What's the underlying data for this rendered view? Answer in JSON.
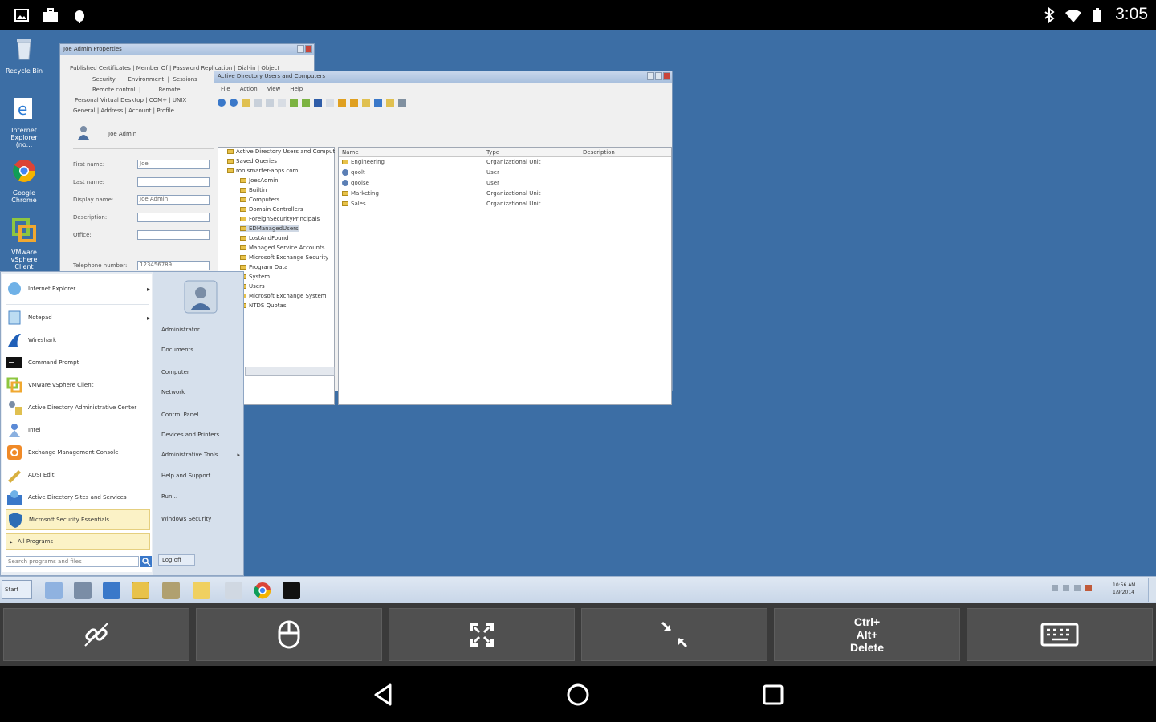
{
  "statusbar": {
    "time": "3:05",
    "left_icons": [
      "image-icon",
      "briefcase-icon",
      "debug-icon"
    ],
    "right_icons": [
      "bluetooth-icon",
      "wifi-icon",
      "battery-icon"
    ]
  },
  "desktop": {
    "background": "#3c6ea5",
    "icons": [
      {
        "label": "Recycle Bin",
        "icon": "recycle-bin-icon"
      },
      {
        "label": "Internet Explorer (no...",
        "icon": "internet-explorer-icon"
      },
      {
        "label": "Google Chrome",
        "icon": "chrome-icon"
      },
      {
        "label": "VMware vSphere Client",
        "icon": "vsphere-icon"
      }
    ]
  },
  "props_window": {
    "title": "Joe Admin Properties",
    "tabs_row1": [
      "Published Certificates",
      "Member Of",
      "Password Replication",
      "Dial-in",
      "Object"
    ],
    "tabs_row2": [
      "Security",
      "Environment",
      "Sessions"
    ],
    "tabs_row3": [
      "Remote control",
      "Remote"
    ],
    "tabs_row4": [
      "Personal Virtual Desktop",
      "COM+",
      "UNIX"
    ],
    "tabs_row5": [
      "General",
      "Address",
      "Account",
      "Profile"
    ],
    "user_display": "Joe Admin",
    "fields": [
      {
        "label": "First name:",
        "value": "Joe"
      },
      {
        "label": "Last name:",
        "value": ""
      },
      {
        "label": "Display name:",
        "value": "Joe Admin"
      },
      {
        "label": "Description:",
        "value": ""
      },
      {
        "label": "Office:",
        "value": ""
      },
      {
        "label": "Telephone number:",
        "value": "123456789"
      }
    ]
  },
  "aduc_window": {
    "title": "Active Directory Users and Computers",
    "menu": [
      "File",
      "Action",
      "View",
      "Help"
    ],
    "tree": [
      "Active Directory Users and Comput",
      "Saved Queries",
      "ron.smarter-apps.com",
      "JoesAdmin",
      "Builtin",
      "Computers",
      "Domain Controllers",
      "ForeignSecurityPrincipals",
      "EDManagedUsers",
      "LostAndFound",
      "Managed Service Accounts",
      "Microsoft Exchange Security",
      "Program Data",
      "System",
      "Users",
      "Microsoft Exchange System",
      "NTDS Quotas"
    ],
    "columns": [
      "Name",
      "Type",
      "Description"
    ],
    "rows": [
      {
        "name": "Engineering",
        "type": "Organizational Unit",
        "description": "",
        "icon": "ou-icon"
      },
      {
        "name": "qoolt",
        "type": "User",
        "description": "",
        "icon": "user-icon"
      },
      {
        "name": "qoolse",
        "type": "User",
        "description": "",
        "icon": "user-icon"
      },
      {
        "name": "Marketing",
        "type": "Organizational Unit",
        "description": "",
        "icon": "ou-icon"
      },
      {
        "name": "Sales",
        "type": "Organizational Unit",
        "description": "",
        "icon": "ou-icon"
      }
    ]
  },
  "start_menu": {
    "left_items": [
      {
        "label": "Internet Explorer",
        "icon": "ie-icon",
        "arrow": true
      },
      {
        "label": "Notepad",
        "icon": "notepad-icon",
        "arrow": true
      },
      {
        "label": "Wireshark",
        "icon": "wireshark-icon",
        "arrow": false
      },
      {
        "label": "Command Prompt",
        "icon": "cmd-icon",
        "arrow": false
      },
      {
        "label": "VMware vSphere Client",
        "icon": "vsphere-icon",
        "arrow": false
      },
      {
        "label": "Active Directory Administrative Center",
        "icon": "adac-icon",
        "arrow": false
      },
      {
        "label": "Intel",
        "icon": "intel-icon",
        "arrow": false
      },
      {
        "label": "Exchange Management Console",
        "icon": "exchange-icon",
        "arrow": false
      },
      {
        "label": "ADSI Edit",
        "icon": "adsi-icon",
        "arrow": false
      },
      {
        "label": "Active Directory Sites and Services",
        "icon": "adss-icon",
        "arrow": false
      },
      {
        "label": "Microsoft Security Essentials",
        "icon": "mse-icon",
        "arrow": false
      }
    ],
    "all_programs": "All Programs",
    "search_placeholder": "Search programs and files",
    "right_items": [
      "Administrator",
      "Documents",
      "Computer",
      "Network",
      "Control Panel",
      "Devices and Printers",
      "Administrative Tools",
      "Help and Support",
      "Run...",
      "Windows Security"
    ],
    "logoff": "Log off"
  },
  "taskbar": {
    "start_label": "Start",
    "tray_time": "10:56 AM",
    "tray_date": "1/9/2014"
  },
  "remote_toolbar": {
    "buttons": [
      {
        "name": "disconnect-button",
        "icon": "unlink-icon"
      },
      {
        "name": "mouse-button",
        "icon": "mouse-icon"
      },
      {
        "name": "fullscreen-button",
        "icon": "expand-icon"
      },
      {
        "name": "fit-screen-button",
        "icon": "shrink-icon"
      },
      {
        "name": "ctrl-alt-delete-button",
        "label_line1": "Ctrl+",
        "label_line2": "Alt+",
        "label_line3": "Delete"
      },
      {
        "name": "keyboard-button",
        "icon": "keyboard-icon"
      }
    ]
  }
}
